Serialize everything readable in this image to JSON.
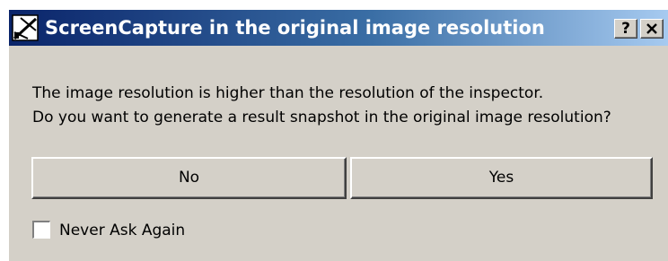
{
  "window": {
    "title": "ScreenCapture in the original image resolution",
    "help_label": "?",
    "close_label": "✕"
  },
  "message": {
    "line1": "The image resolution is higher than the resolution of the inspector.",
    "line2": "Do you want to generate a result snapshot in the original image resolution?"
  },
  "buttons": {
    "no_label": "No",
    "yes_label": "Yes"
  },
  "checkbox": {
    "label": "Never Ask Again",
    "checked": false
  },
  "colors": {
    "titlebar_start": "#0a246a",
    "titlebar_end": "#a6caf0",
    "dialog_background": "#d4d0c8"
  },
  "icons": {
    "app": "screen-capture-icon"
  }
}
